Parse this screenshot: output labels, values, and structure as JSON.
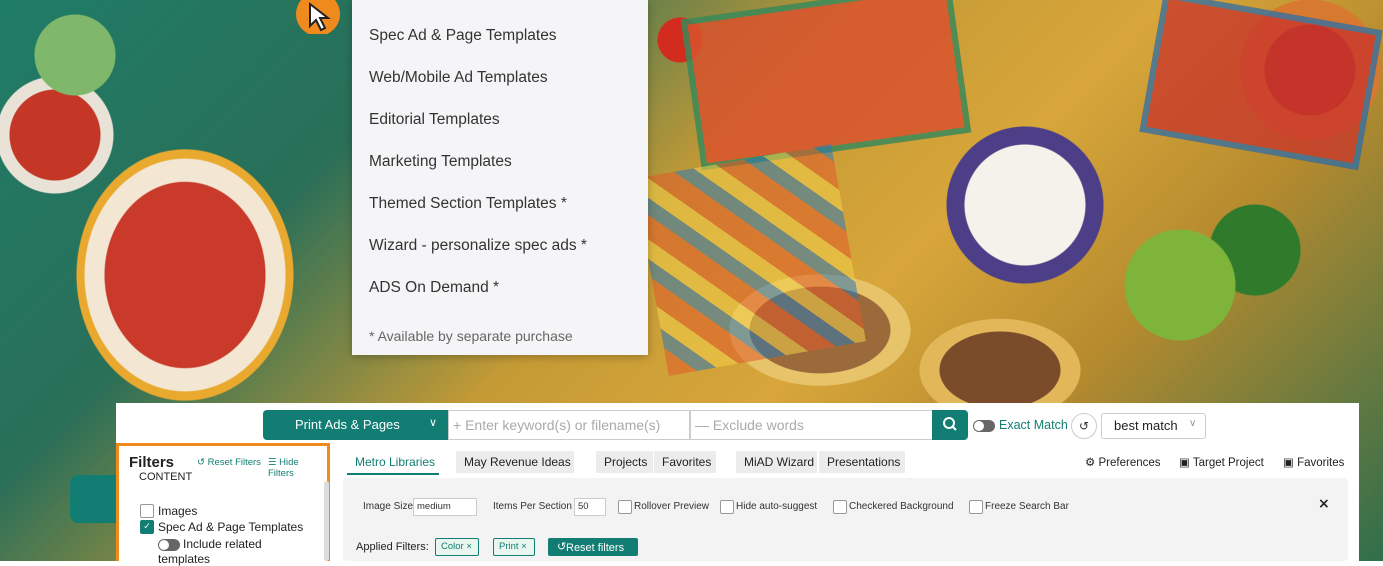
{
  "menu": {
    "items": [
      "Spec Ad & Page Templates",
      "Web/Mobile Ad Templates",
      "Editorial Templates",
      "Marketing Templates",
      "Themed Section Templates *",
      "Wizard - personalize spec ads *",
      "ADS On Demand *"
    ],
    "note": "* Available by separate purchase"
  },
  "search": {
    "category": "Print Ads & Pages",
    "keyword_placeholder": "+ Enter keyword(s) or filename(s)",
    "exclude_placeholder": "— Exclude words",
    "exact_match_label": "Exact Match",
    "sort": "best match"
  },
  "filters": {
    "title": "Filters",
    "reset_label": "Reset Filters",
    "hide_label": "Hide Filters",
    "section": "CONTENT",
    "options": [
      {
        "label": "Images",
        "checked": false
      },
      {
        "label": "Spec Ad & Page Templates",
        "checked": true
      }
    ],
    "related_toggle": "Include related",
    "related_toggle_2": "templates"
  },
  "tabs": [
    "Metro Libraries",
    "May Revenue Ideas",
    "Projects",
    "Favorites",
    "MiAD Wizard",
    "Presentations"
  ],
  "toplinks": {
    "preferences": "Preferences",
    "target_project": "Target Project",
    "favorites": "Favorites"
  },
  "prefs": {
    "image_size_label": "Image Size",
    "image_size_value": "medium",
    "items_label": "Items Per Section",
    "items_value": "50",
    "rollover": "Rollover Preview",
    "hide_suggest": "Hide auto-suggest",
    "checkered": "Checkered Background",
    "freeze": "Freeze Search Bar"
  },
  "applied": {
    "label": "Applied Filters:",
    "chips": [
      "Color ×",
      "Print ×"
    ],
    "reset": "Reset filters"
  },
  "colors": {
    "accent": "#117d73",
    "highlight": "#f08a1d"
  }
}
